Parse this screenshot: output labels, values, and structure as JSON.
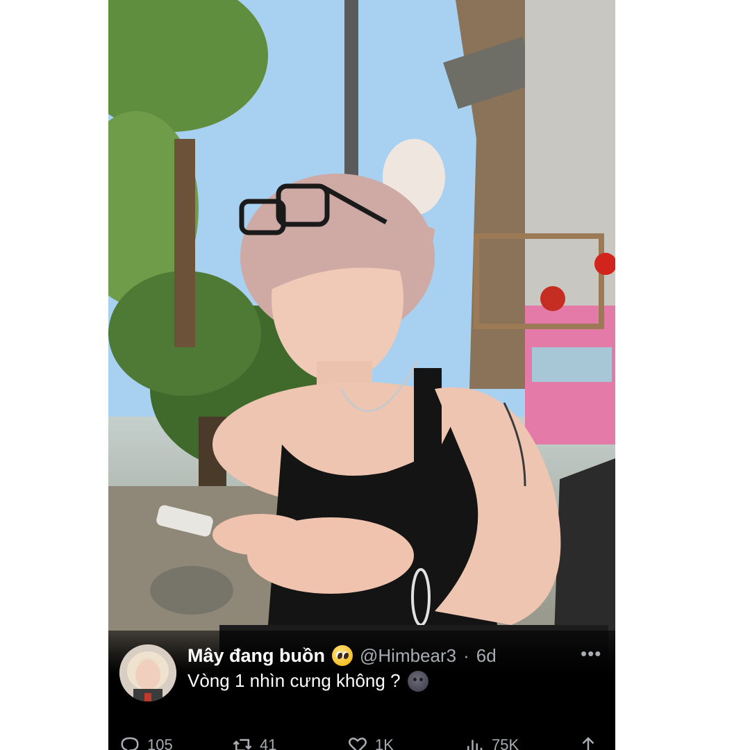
{
  "tweet": {
    "display_name": "Mây đang buồn",
    "name_emoji": "pleading-face-emoji",
    "handle": "@Himbear3",
    "separator": "·",
    "time": "6d",
    "text": "Vòng 1 nhìn cưng không ?",
    "text_emoji": "new-moon-face-emoji",
    "more_label": "•••"
  },
  "actions": {
    "replies": "105",
    "retweets": "41",
    "likes": "1K",
    "views": "75K"
  },
  "icons": [
    "reply-icon",
    "retweet-icon",
    "like-icon",
    "views-icon",
    "share-icon",
    "more-icon"
  ],
  "colors": {
    "background": "#000000",
    "text_primary": "#ffffff",
    "text_secondary": "#a8adb3"
  }
}
